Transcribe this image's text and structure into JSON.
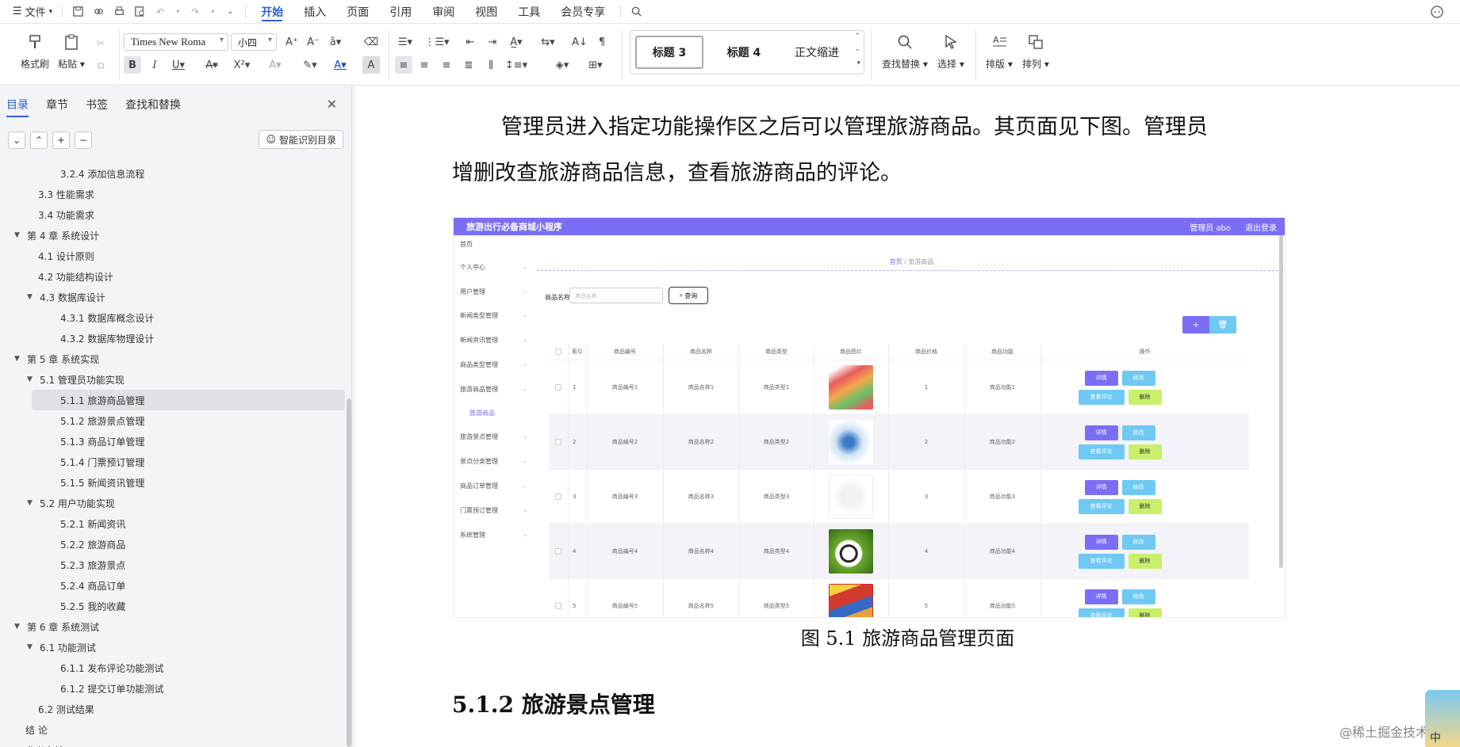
{
  "menubar": {
    "file_label": "文件",
    "tabs": [
      "开始",
      "插入",
      "页面",
      "引用",
      "审阅",
      "视图",
      "工具",
      "会员专享"
    ],
    "active_tab": "开始"
  },
  "ribbon": {
    "format_painter": "格式刷",
    "paste": "粘贴",
    "font_name": "Times New Roma",
    "font_size": "小四",
    "styles": [
      "标题 3",
      "标题 4",
      "正文缩进"
    ],
    "find_replace": "查找替换",
    "select": "选择",
    "layout": "排版",
    "arrange": "排列"
  },
  "nav": {
    "tabs": [
      "目录",
      "章节",
      "书签",
      "查找和替换"
    ],
    "smart_toc": "智能识别目录",
    "toc": [
      {
        "level": 3,
        "text": "3.2.4  添加信息流程",
        "caret": false
      },
      {
        "level": 2,
        "text": "3.3  性能需求",
        "caret": false
      },
      {
        "level": 2,
        "text": "3.4  功能需求",
        "caret": false
      },
      {
        "level": 1,
        "text": "第 4 章  系统设计",
        "caret": true
      },
      {
        "level": 2,
        "text": "4.1  设计原则",
        "caret": false
      },
      {
        "level": 2,
        "text": "4.2  功能结构设计",
        "caret": false
      },
      {
        "level": 2,
        "text": "4.3  数据库设计",
        "caret": true
      },
      {
        "level": 3,
        "text": "4.3.1  数据库概念设计",
        "caret": false
      },
      {
        "level": 3,
        "text": "4.3.2  数据库物理设计",
        "caret": false
      },
      {
        "level": 1,
        "text": "第 5 章  系统实现",
        "caret": true
      },
      {
        "level": 2,
        "text": "5.1  管理员功能实现",
        "caret": true
      },
      {
        "level": 3,
        "text": "5.1.1  旅游商品管理",
        "caret": false,
        "selected": true
      },
      {
        "level": 3,
        "text": "5.1.2  旅游景点管理",
        "caret": false
      },
      {
        "level": 3,
        "text": "5.1.3  商品订单管理",
        "caret": false
      },
      {
        "level": 3,
        "text": "5.1.4  门票预订管理",
        "caret": false
      },
      {
        "level": 3,
        "text": "5.1.5  新闻资讯管理",
        "caret": false
      },
      {
        "level": 2,
        "text": "5.2  用户功能实现",
        "caret": true
      },
      {
        "level": 3,
        "text": "5.2.1  新闻资讯",
        "caret": false
      },
      {
        "level": 3,
        "text": "5.2.2  旅游商品",
        "caret": false
      },
      {
        "level": 3,
        "text": "5.2.3  旅游景点",
        "caret": false
      },
      {
        "level": 3,
        "text": "5.2.4  商品订单",
        "caret": false
      },
      {
        "level": 3,
        "text": "5.2.5  我的收藏",
        "caret": false
      },
      {
        "level": 1,
        "text": "第 6 章  系统测试",
        "caret": true
      },
      {
        "level": 2,
        "text": "6.1  功能测试",
        "caret": true
      },
      {
        "level": 3,
        "text": "6.1.1  发布评论功能测试",
        "caret": false
      },
      {
        "level": 3,
        "text": "6.1.2  提交订单功能测试",
        "caret": false
      },
      {
        "level": 2,
        "text": "6.2  测试结果",
        "caret": false
      },
      {
        "level": 1,
        "text": "结    论",
        "caret": false
      },
      {
        "level": 1,
        "text": "参考文献",
        "caret": false
      }
    ]
  },
  "doc": {
    "para_line1": "管理员进入指定功能操作区之后可以管理旅游商品。其页面见下图。管理员",
    "para_line2": "增删改查旅游商品信息，查看旅游商品的评论。",
    "caption": "图 5.1  旅游商品管理页面",
    "heading": "5.1.2  旅游景点管理",
    "watermark": "@稀土掘金技术社区",
    "corner_text": "中"
  },
  "app": {
    "title": "旅游出行必备商城小程序",
    "user": "管理员 abo",
    "logout": "退出登录",
    "menu": [
      "首页",
      "个人中心",
      "用户管理",
      "新闻类型管理",
      "新闻资讯管理",
      "商品类型管理",
      "旅游商品管理",
      "旅游商品",
      "旅游景点管理",
      "景点分类管理",
      "商品订单管理",
      "门票预订管理",
      "系统管理"
    ],
    "crumb_home": "首页",
    "crumb_current": "旅游商品",
    "search_label": "商品名称",
    "search_placeholder": "商品名称",
    "search_btn": "查询",
    "add_btn": "+",
    "del_btn": "🗑",
    "headers": [
      "索引",
      "商品编号",
      "商品名称",
      "商品类型",
      "商品图片",
      "商品价格",
      "商品功能",
      "操作"
    ],
    "rows": [
      {
        "idx": "1",
        "code": "商品编号1",
        "name": "商品名称1",
        "type": "商品类型1",
        "price": "1",
        "func": "商品功能1"
      },
      {
        "idx": "2",
        "code": "商品编号2",
        "name": "商品名称2",
        "type": "商品类型2",
        "price": "2",
        "func": "商品功能2"
      },
      {
        "idx": "3",
        "code": "商品编号3",
        "name": "商品名称3",
        "type": "商品类型3",
        "price": "3",
        "func": "商品功能3"
      },
      {
        "idx": "4",
        "code": "商品编号4",
        "name": "商品名称4",
        "type": "商品类型4",
        "price": "4",
        "func": "商品功能4"
      },
      {
        "idx": "5",
        "code": "商品编号5",
        "name": "商品名称5",
        "type": "商品类型5",
        "price": "5",
        "func": "商品功能5"
      }
    ],
    "op_detail": "详情",
    "op_edit": "修改",
    "op_comment": "查看评论",
    "op_delete": "删除"
  }
}
